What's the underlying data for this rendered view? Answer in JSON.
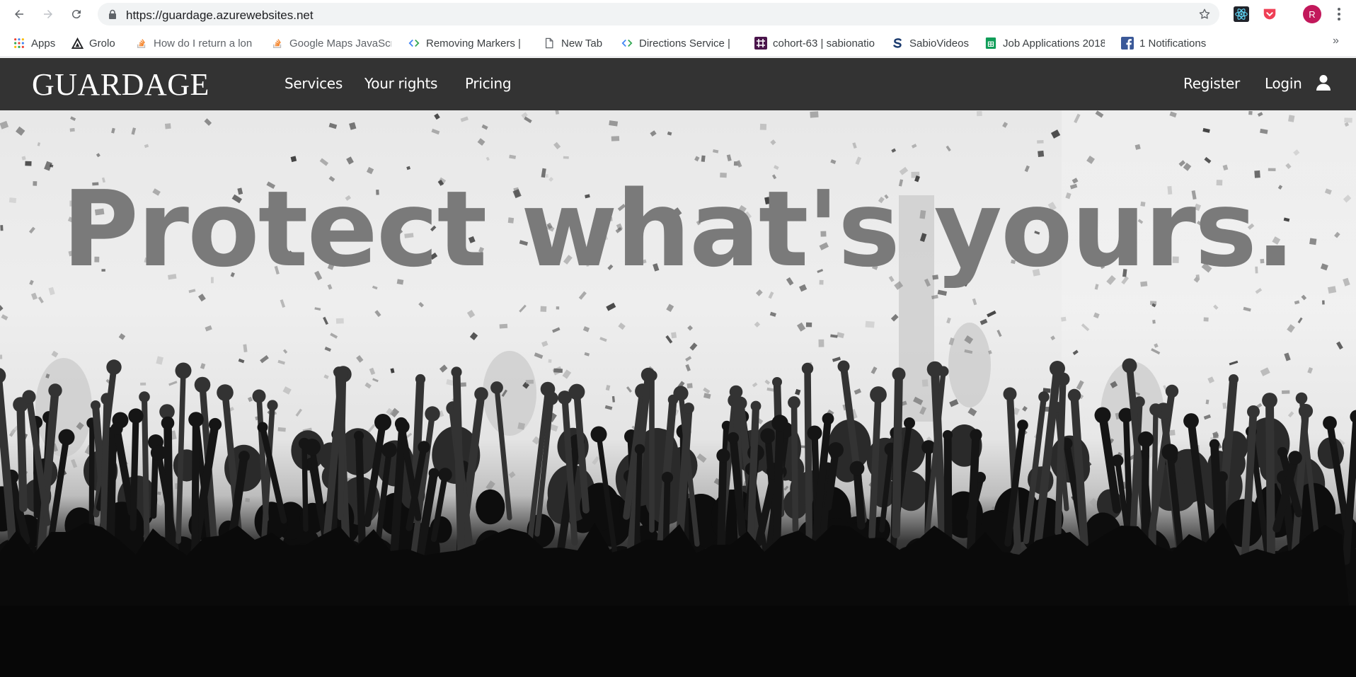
{
  "browser": {
    "url": "https://guardage.azurewebsites.net",
    "profile_initial": "R",
    "bookmarks": [
      {
        "label": "Apps",
        "icon": "apps-grid-icon"
      },
      {
        "label": "Grolo",
        "icon": "grolo-icon"
      },
      {
        "label": "How do I return a lon",
        "icon": "stackoverflow-icon"
      },
      {
        "label": "Google Maps JavaScr",
        "icon": "stackoverflow-icon"
      },
      {
        "label": "Removing Markers |",
        "icon": "google-developers-icon"
      },
      {
        "label": "New Tab",
        "icon": "page-icon"
      },
      {
        "label": "Directions Service | ",
        "icon": "google-developers-icon"
      },
      {
        "label": "cohort-63 | sabionatio",
        "icon": "slack-icon"
      },
      {
        "label": "SabioVideos",
        "icon": "sabio-icon"
      },
      {
        "label": "Job Applications 2018",
        "icon": "google-sheets-icon"
      },
      {
        "label": "1 Notifications",
        "icon": "facebook-icon"
      }
    ],
    "colors": {
      "omnibox": "#f1f3f4",
      "avatar": "#c2185b"
    }
  },
  "site": {
    "logo": "GUARDAGE",
    "nav": {
      "services": "Services",
      "rights": "Your rights",
      "pricing": "Pricing",
      "register": "Register",
      "login": "Login"
    },
    "hero": {
      "headline": "Protect what's yours."
    },
    "colors": {
      "navbar": "#333333",
      "headline": "#7a7a7a"
    }
  }
}
